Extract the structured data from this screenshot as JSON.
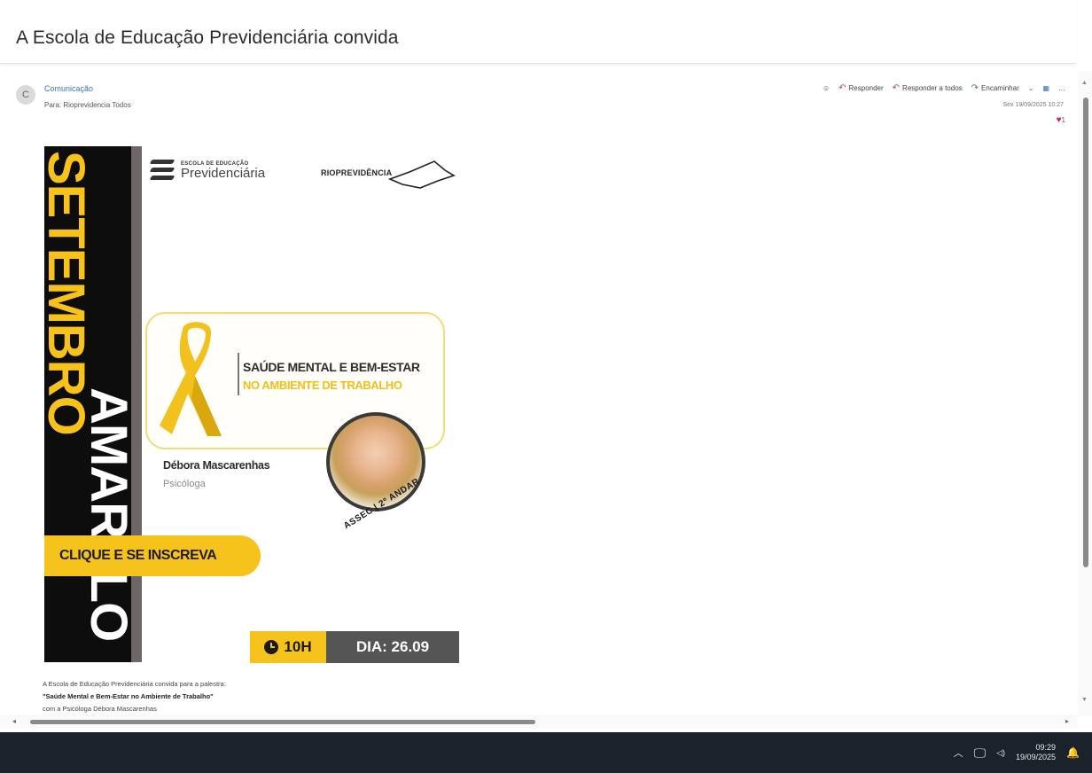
{
  "subject": "A Escola de Educação Previdenciária convida",
  "message": {
    "avatar_initial": "C",
    "sender": "Comunicação",
    "to": "Para: Rioprevidencia Todos",
    "date": "Sex 19/09/2025 10:27",
    "reaction_count": "1",
    "actions": {
      "reply": "Responder",
      "reply_all": "Responder a todos",
      "forward": "Encaminhar"
    }
  },
  "banner": {
    "vertical_yellow": "SETEMBRO",
    "vertical_white": "AMARELO",
    "logo_escola_small": "ESCOLA DE EDUCAÇÃO",
    "logo_escola_big": "Previdenciária",
    "logo_rio": "RIOPREVIDÊNCIA",
    "topic_line1": "SAÚDE MENTAL E BEM-ESTAR",
    "topic_line2": "NO AMBIENTE DE TRABALHO",
    "speaker_name": "Débora Mascarenhas",
    "speaker_role": "Psicóloga",
    "location": "ASSEC | 2º ANDAR",
    "cta": "CLIQUE E SE INSCREVA",
    "time": "10H",
    "date": "DIA: 26.09"
  },
  "body_text": {
    "line1": "A Escola de Educação Previdenciária convida para a palestra:",
    "line2": "\"Saúde Mental e Bem-Estar no Ambiente de Trabalho\"",
    "line3": "com a Psicóloga Débora Mascarenhas"
  },
  "taskbar": {
    "time": "09:29",
    "date": "19/09/2025"
  },
  "colors": {
    "accent_yellow": "#f6c21c",
    "dark": "#0d0d0d",
    "date_gray": "#555555",
    "taskbar": "#1c222b"
  }
}
